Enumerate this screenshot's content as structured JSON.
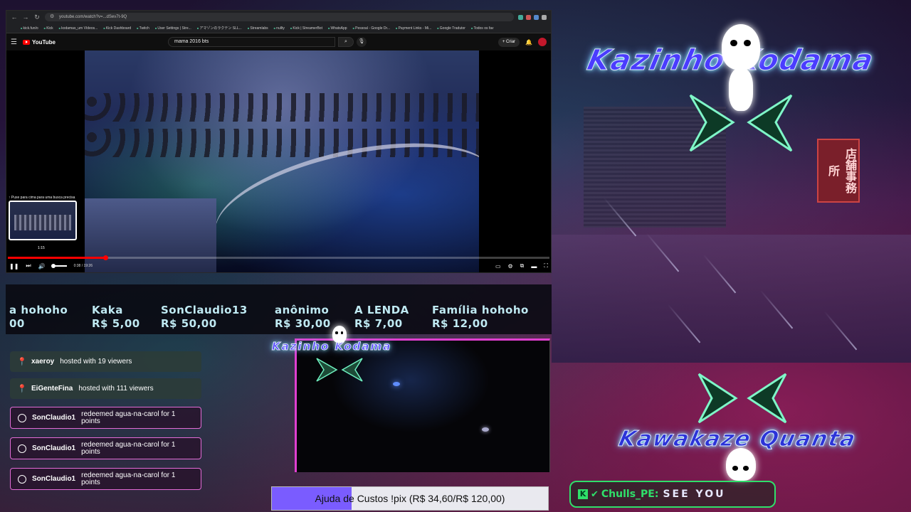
{
  "browser": {
    "url": "youtube.com/watch?v=...dSev7t-9Q",
    "bookmarks": [
      "kick.fun/o",
      "Kick",
      "kodamas_um Vídeos...",
      "Kick Dashboard",
      "Twitch",
      "User Settings | Stre...",
      "アマゾンのラクテン SLL...",
      "Streamlabs",
      "nullty",
      "Kick | StreamerBot",
      "WhatsApp",
      "Pessoal - Google Dr...",
      "Payment Links - Mi...",
      "Google Tradutor",
      "Todos os fav"
    ]
  },
  "youtube": {
    "logo_label": "YouTube",
    "search_query": "mama 2016 bts",
    "create_label": "Criar",
    "preview_tip": "↑ Puxe para cima para uma busca precisa",
    "preview_time": "1:15",
    "time_label": "0:38 / 19:26",
    "progress_fraction": 0.18
  },
  "ticker": {
    "donations": [
      {
        "name": "a hohoho",
        "amount": "00"
      },
      {
        "name": "Kaka",
        "amount": "R$ 5,00"
      },
      {
        "name": "SonClaudio13",
        "amount": "R$ 50,00"
      },
      {
        "name": "anônimo",
        "amount": "R$ 30,00"
      },
      {
        "name": "A LENDA",
        "amount": "R$ 7,00"
      },
      {
        "name": "Família hohoho",
        "amount": "R$ 12,00"
      }
    ]
  },
  "events": [
    {
      "user": "xaeroy",
      "text": "hosted with 19 viewers"
    },
    {
      "user": "EiGenteFina",
      "text": "hosted with 111 viewers"
    },
    {
      "user": "SonClaudio1",
      "text": "redeemed agua-na-carol for 1 points"
    },
    {
      "user": "SonClaudio1",
      "text": "redeemed agua-na-carol for 1 points"
    },
    {
      "user": "SonClaudio1",
      "text": "redeemed agua-na-carol for 1 points"
    }
  ],
  "goal": {
    "text": "Ajuda de Custos !pix (R$ 34,60/R$ 120,00)",
    "current": 34.6,
    "target": 120.0,
    "fill_color": "#7a5cff"
  },
  "chat": {
    "platform_icon": "K",
    "user": "Chulls_PE:",
    "message": "SEE YOU"
  },
  "logos": {
    "main": "Kazinho Kodama",
    "cam": "Kazinho Kodama",
    "bottom": "Kawakaze Quanta"
  },
  "background": {
    "sign_text": "店舗事務所"
  },
  "colors": {
    "accent_pink": "#e03fd0",
    "accent_green": "#2fe06a",
    "youtube_red": "#ff0000"
  }
}
